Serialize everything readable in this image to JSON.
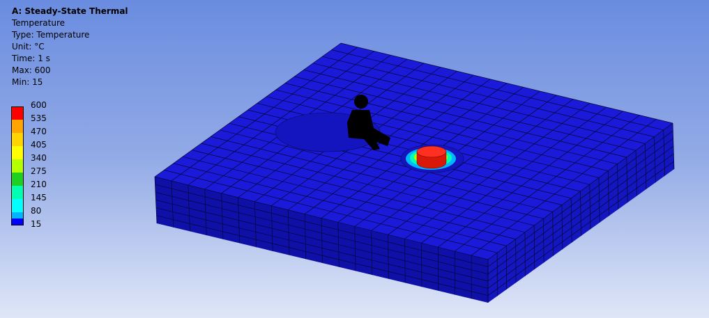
{
  "info": {
    "title": "A: Steady-State Thermal",
    "result": "Temperature",
    "type": "Type: Temperature",
    "unit": "Unit: °C",
    "time": "Time: 1 s",
    "max": "Max: 600",
    "min": "Min: 15"
  },
  "legend": [
    {
      "label": "600",
      "color": "#ff0000"
    },
    {
      "label": "535",
      "color": "#ffa500"
    },
    {
      "label": "470",
      "color": "#ffd400"
    },
    {
      "label": "405",
      "color": "#ffff00"
    },
    {
      "label": "340",
      "color": "#b4ff00"
    },
    {
      "label": "275",
      "color": "#20d020"
    },
    {
      "label": "210",
      "color": "#00ffb0"
    },
    {
      "label": "145",
      "color": "#00ffff"
    },
    {
      "label": "80",
      "color": "#00b4ff"
    },
    {
      "label": "15",
      "color": "#0000ff"
    }
  ],
  "colors": {
    "plate_top": "#1a1ad8",
    "plate_front": "#0e10a8",
    "plate_side": "#1416bf",
    "mesh_line": "#060630",
    "hot_spot": "#e02010",
    "probe": "#000000"
  }
}
